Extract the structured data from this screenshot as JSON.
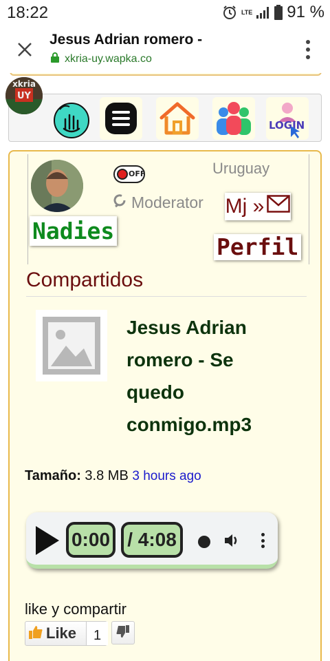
{
  "status_bar": {
    "time": "18:22",
    "battery_percent": "91 %",
    "network": "LTE"
  },
  "browser": {
    "title": "Jesus Adrian romero -",
    "url": "xkria-uy.wapka.co"
  },
  "site": {
    "logo_text": "xkria UY",
    "nav_icons": [
      "hand-wave-icon",
      "menu-icon",
      "home-icon",
      "users-icon",
      "login-icon"
    ],
    "login_label": "LOGIN"
  },
  "profile": {
    "status_toggle": "OFF",
    "country": "Uruguay",
    "role": "Moderator",
    "username": "Nadies",
    "message_label": "Mj »",
    "profile_label": "Perfil"
  },
  "shared": {
    "section_title": "Compartidos",
    "file_name": "Jesus Adrian romero - Se quedo conmigo.mp3",
    "size_label": "Tamaño:",
    "size_value": "3.8 MB",
    "uploaded": "3 hours ago"
  },
  "player": {
    "current_time": "0:00",
    "duration": "/ 4:08"
  },
  "social": {
    "prompt": "like y compartir",
    "like_label": "Like",
    "like_count": "1"
  },
  "colors": {
    "accent_border": "#e8b94c",
    "card_bg": "#fffde8",
    "title_red": "#6a0e0e",
    "name_green": "#0e8a1e",
    "time_blue": "#1a1acc",
    "player_green": "#b8e0a8"
  }
}
